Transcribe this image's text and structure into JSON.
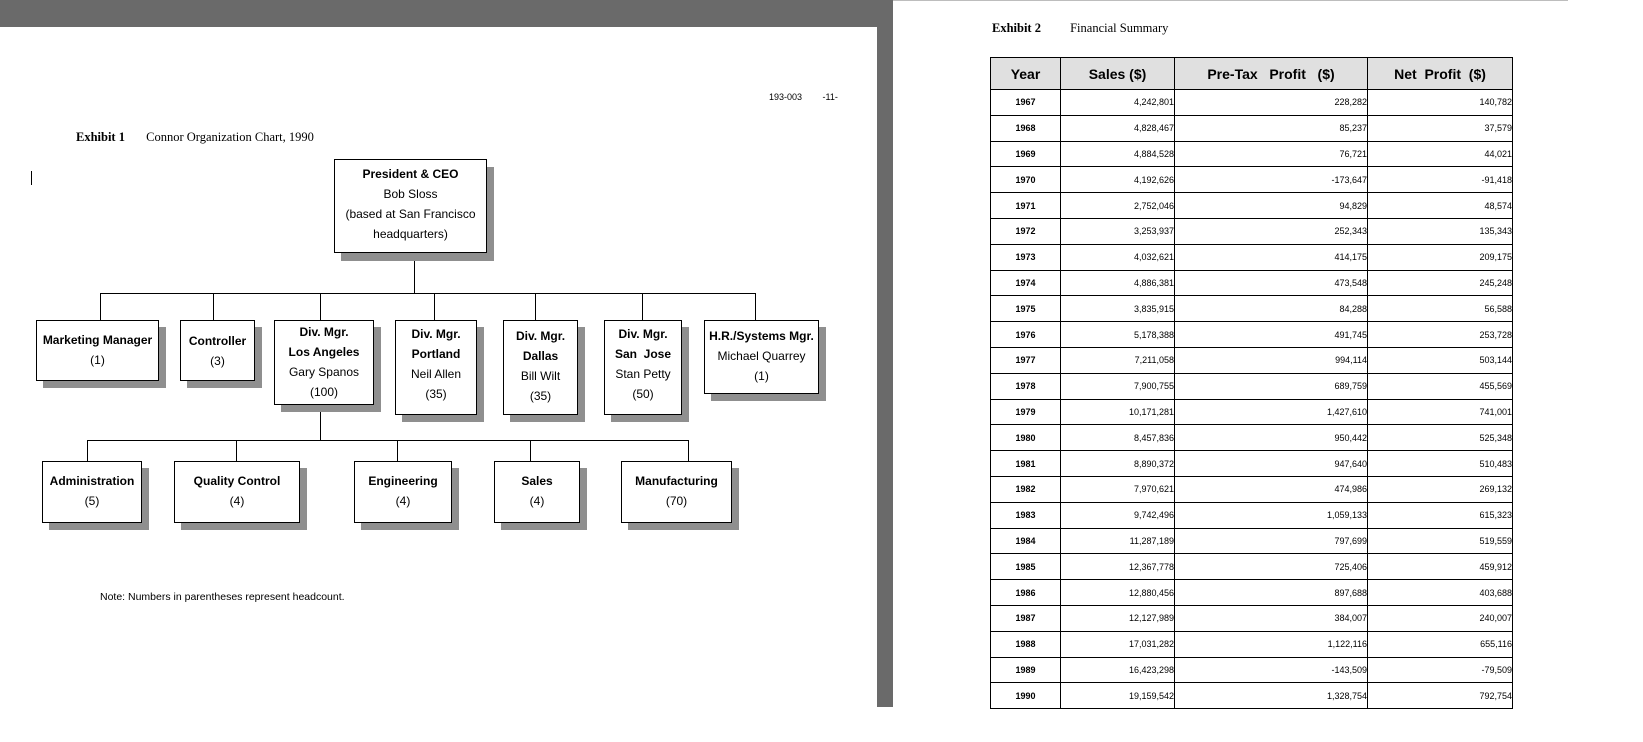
{
  "left_document": {
    "header": {
      "doc_code": "193-003",
      "page_number": "-11-"
    },
    "exhibit": {
      "label": "Exhibit 1",
      "caption": "Connor Organization Chart, 1990"
    },
    "org_chart": {
      "root": {
        "title": "President & CEO",
        "name": "Bob Sloss",
        "detail_line1": "(based at San Francisco",
        "detail_line2": "headquarters)"
      },
      "level1": [
        {
          "title": "Marketing Manager",
          "headcount": "(1)"
        },
        {
          "title": "Controller",
          "headcount": "(3)"
        },
        {
          "title": "Div. Mgr.",
          "location": "Los Angeles",
          "name": "Gary Spanos",
          "headcount": "(100)"
        },
        {
          "title": "Div. Mgr.",
          "location": "Portland",
          "name": "Neil Allen",
          "headcount": "(35)"
        },
        {
          "title": "Div. Mgr.",
          "location": "Dallas",
          "name": "Bill Wilt",
          "headcount": "(35)"
        },
        {
          "title": "Div. Mgr.",
          "location": "San  Jose",
          "name": "Stan Petty",
          "headcount": "(50)"
        },
        {
          "title": "H.R./Systems Mgr.",
          "name": "Michael Quarrey",
          "headcount": "(1)"
        }
      ],
      "level2": [
        {
          "title": "Administration",
          "headcount": "(5)"
        },
        {
          "title": "Quality Control",
          "headcount": "(4)"
        },
        {
          "title": "Engineering",
          "headcount": "(4)"
        },
        {
          "title": "Sales",
          "headcount": "(4)"
        },
        {
          "title": "Manufacturing",
          "headcount": "(70)"
        }
      ]
    },
    "note": "Note: Numbers in parentheses represent headcount."
  },
  "right_document": {
    "exhibit": {
      "label": "Exhibit 2",
      "caption": "Financial Summary"
    },
    "table": {
      "headers": [
        "Year",
        "Sales ($)",
        "Pre-Tax   Profit   ($)",
        "Net  Profit  ($)"
      ],
      "rows": [
        [
          "1967",
          "4,242,801",
          "228,282",
          "140,782"
        ],
        [
          "1968",
          "4,828,467",
          "85,237",
          "37,579"
        ],
        [
          "1969",
          "4,884,528",
          "76,721",
          "44,021"
        ],
        [
          "1970",
          "4,192,626",
          "-173,647",
          "-91,418"
        ],
        [
          "1971",
          "2,752,046",
          "94,829",
          "48,574"
        ],
        [
          "1972",
          "3,253,937",
          "252,343",
          "135,343"
        ],
        [
          "1973",
          "4,032,621",
          "414,175",
          "209,175"
        ],
        [
          "1974",
          "4,886,381",
          "473,548",
          "245,248"
        ],
        [
          "1975",
          "3,835,915",
          "84,288",
          "56,588"
        ],
        [
          "1976",
          "5,178,388",
          "491,745",
          "253,728"
        ],
        [
          "1977",
          "7,211,058",
          "994,114",
          "503,144"
        ],
        [
          "1978",
          "7,900,755",
          "689,759",
          "455,569"
        ],
        [
          "1979",
          "10,171,281",
          "1,427,610",
          "741,001"
        ],
        [
          "1980",
          "8,457,836",
          "950,442",
          "525,348"
        ],
        [
          "1981",
          "8,890,372",
          "947,640",
          "510,483"
        ],
        [
          "1982",
          "7,970,621",
          "474,986",
          "269,132"
        ],
        [
          "1983",
          "9,742,496",
          "1,059,133",
          "615,323"
        ],
        [
          "1984",
          "11,287,189",
          "797,699",
          "519,559"
        ],
        [
          "1985",
          "12,367,778",
          "725,406",
          "459,912"
        ],
        [
          "1986",
          "12,880,456",
          "897,688",
          "403,688"
        ],
        [
          "1987",
          "12,127,989",
          "384,007",
          "240,007"
        ],
        [
          "1988",
          "17,031,282",
          "1,122,116",
          "655,116"
        ],
        [
          "1989",
          "16,423,298",
          "-143,509",
          "-79,509"
        ],
        [
          "1990",
          "19,159,542",
          "1,328,754",
          "792,754"
        ]
      ]
    }
  }
}
